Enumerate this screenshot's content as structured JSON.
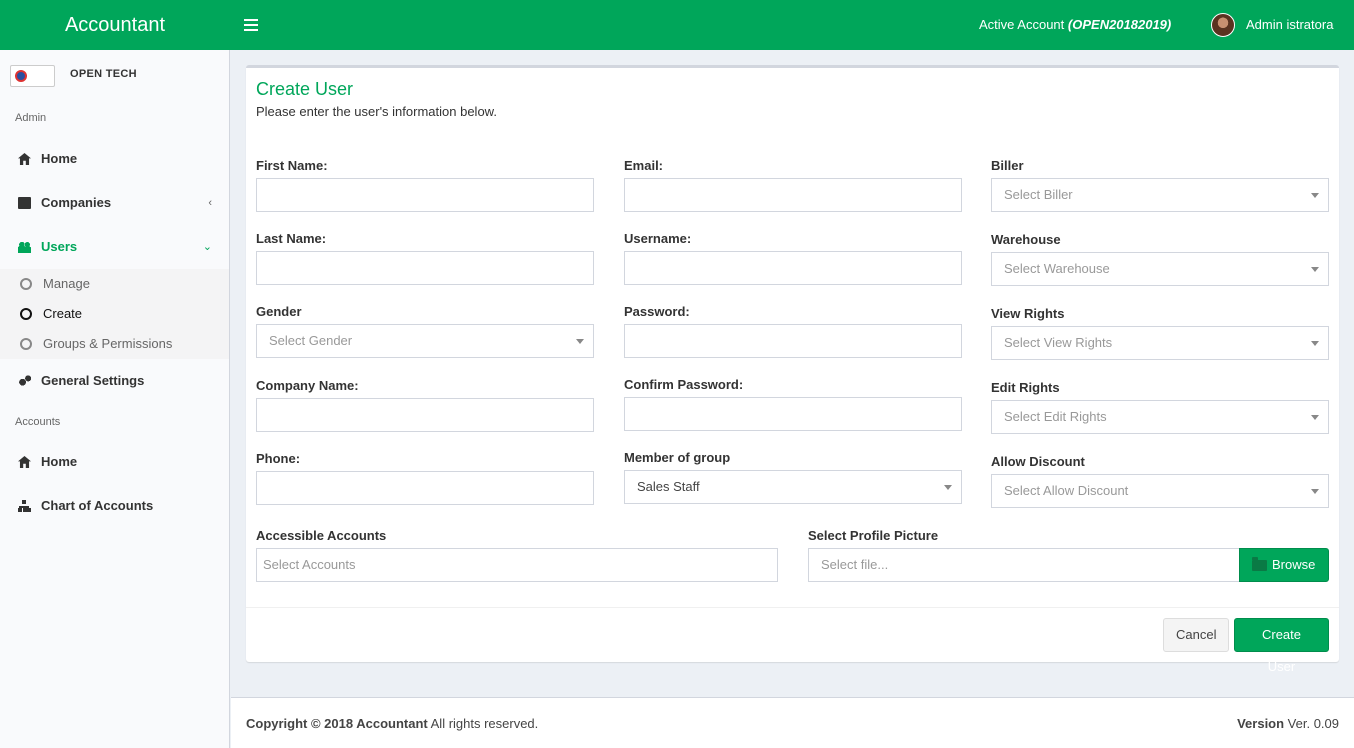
{
  "header": {
    "app_name": "Accountant",
    "active_account_label": "Active Account",
    "active_account_code": "(OPEN20182019)",
    "user_name": "Admin istratora",
    "brand_color": "#00a65a"
  },
  "sidebar": {
    "brand_name": "OPEN TECH",
    "section_admin": "Admin",
    "section_accounts": "Accounts",
    "items": {
      "home": "Home",
      "companies": "Companies",
      "users": "Users",
      "general_settings": "General Settings",
      "accounts_home": "Home",
      "chart_of_accounts": "Chart of Accounts"
    },
    "users_sub": {
      "manage": "Manage",
      "create": "Create",
      "groups": "Groups & Permissions"
    }
  },
  "form": {
    "title": "Create User",
    "subtitle": "Please enter the user's information below.",
    "labels": {
      "first_name": "First Name:",
      "last_name": "Last Name:",
      "gender": "Gender",
      "company_name": "Company Name:",
      "phone": "Phone:",
      "email": "Email:",
      "username": "Username:",
      "password": "Password:",
      "confirm_password": "Confirm Password:",
      "member_of_group": "Member of group",
      "biller": "Biller",
      "warehouse": "Warehouse",
      "view_rights": "View Rights",
      "edit_rights": "Edit Rights",
      "allow_discount": "Allow Discount",
      "accessible_accounts": "Accessible Accounts",
      "profile_picture": "Select Profile Picture"
    },
    "placeholders": {
      "gender": "Select Gender",
      "biller": "Select Biller",
      "warehouse": "Select Warehouse",
      "view_rights": "Select View Rights",
      "edit_rights": "Select Edit Rights",
      "allow_discount": "Select Allow Discount",
      "accounts": "Select Accounts",
      "file": "Select file..."
    },
    "values": {
      "member_of_group": "Sales Staff"
    },
    "browse_label": "Browse",
    "cancel_label": "Cancel",
    "submit_label": "Create User"
  },
  "footer": {
    "copyright_bold": "Copyright © 2018 Accountant",
    "copyright_rest": " All rights reserved.",
    "version_label": "Version",
    "version_number": " Ver. 0.09"
  }
}
